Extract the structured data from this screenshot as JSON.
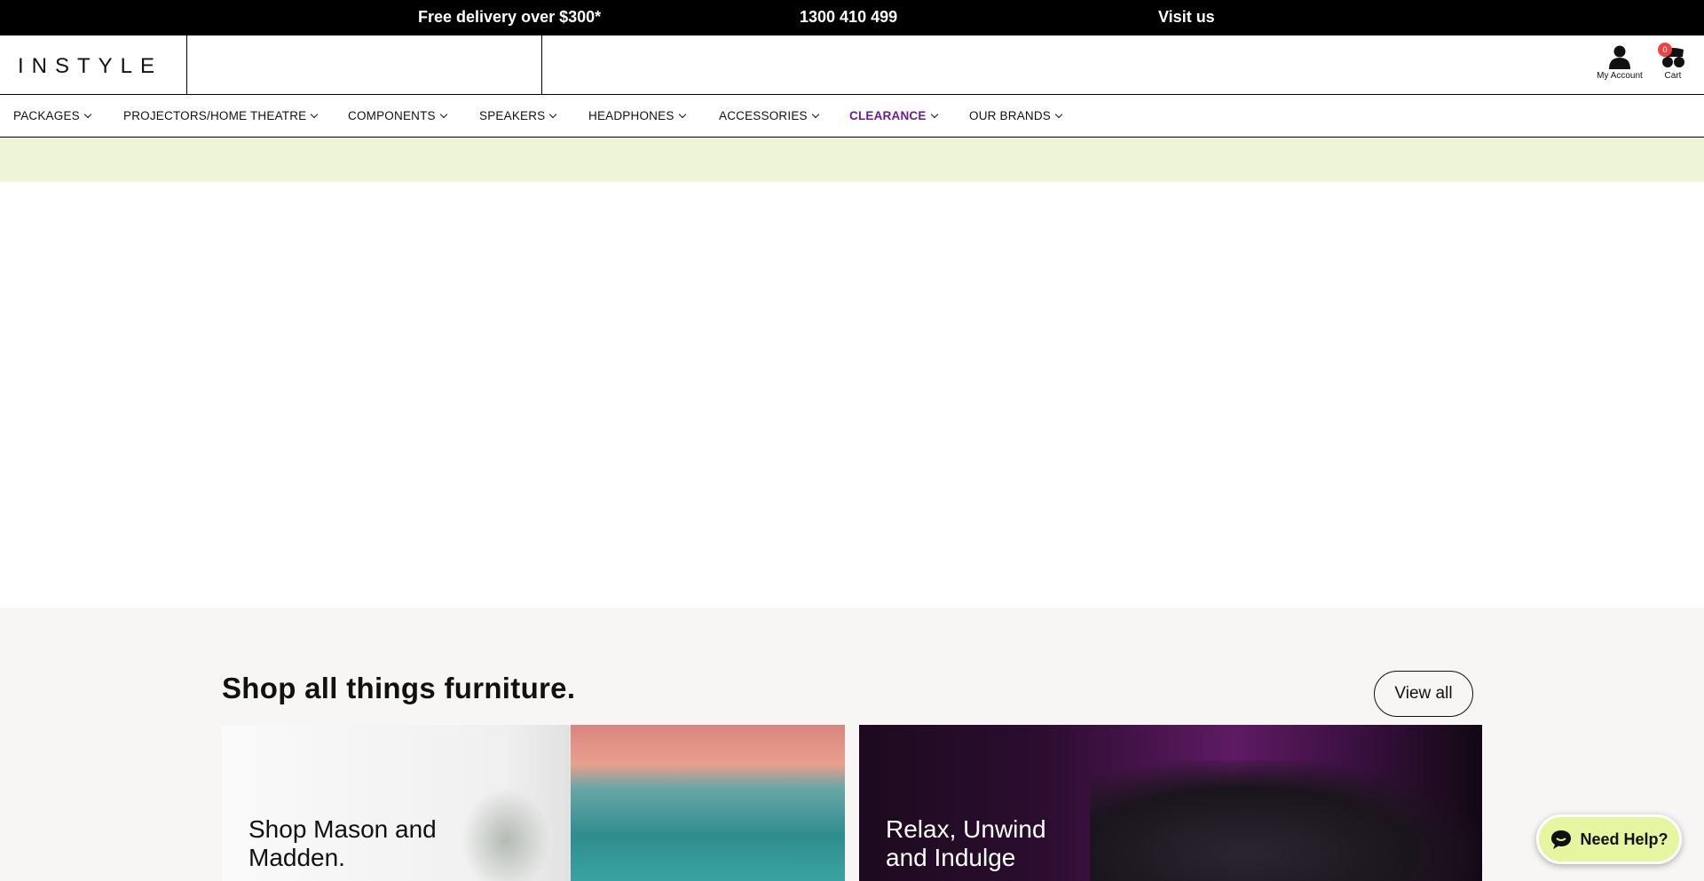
{
  "topbar": {
    "delivery": "Free delivery over $300*",
    "phone": "1300 410 499",
    "visit": "Visit us"
  },
  "header": {
    "logo": "INSTYLE",
    "search_placeholder": "",
    "account_label": "My Account",
    "cart_label": "Cart",
    "cart_count": "0"
  },
  "nav": {
    "items": [
      {
        "label": "PACKAGES"
      },
      {
        "label": "PROJECTORS/HOME THEATRE"
      },
      {
        "label": "COMPONENTS"
      },
      {
        "label": "SPEAKERS"
      },
      {
        "label": "HEADPHONES"
      },
      {
        "label": "ACCESSORIES"
      },
      {
        "label_a": "CLEARANCE"
      },
      {
        "label": "OUR BRANDS"
      }
    ]
  },
  "furniture": {
    "heading": "Shop all things furniture.",
    "view_all": "View all",
    "cards": [
      {
        "title_line1": "Shop Mason and",
        "title_line2": "Madden."
      },
      {
        "title_line1": "Relax, Unwind",
        "title_line2": "and Indulge"
      }
    ]
  },
  "chat": {
    "label": "Need Help?"
  },
  "colors": {
    "promo_strip": "#eef5d6",
    "clearance_gradient_start": "#6b1a9a",
    "clearance_gradient_end": "#c0175f",
    "chat_bg": "#e6f5a0"
  }
}
